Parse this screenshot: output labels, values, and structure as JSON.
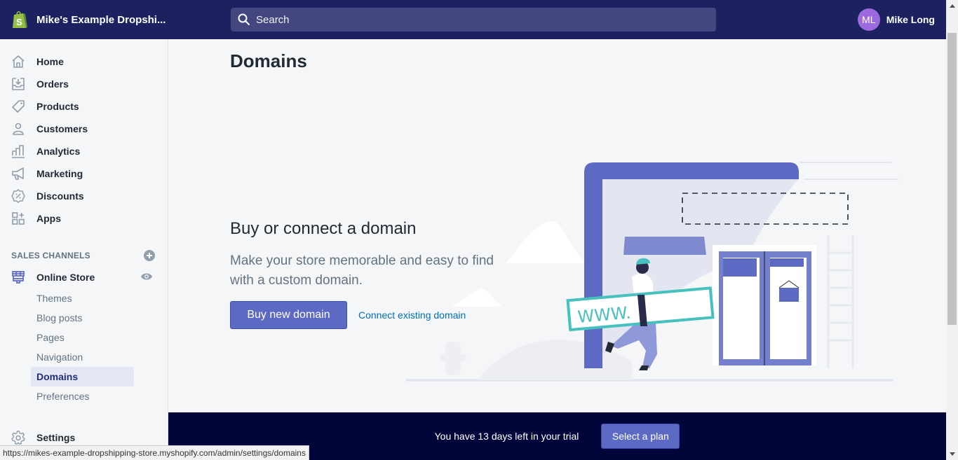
{
  "topbar": {
    "store_name": "Mike's Example Dropshi...",
    "search_placeholder": "Search",
    "user_initials": "ML",
    "user_name": "Mike Long"
  },
  "sidebar": {
    "items": [
      {
        "label": "Home",
        "icon": "home-icon"
      },
      {
        "label": "Orders",
        "icon": "orders-icon"
      },
      {
        "label": "Products",
        "icon": "tag-icon"
      },
      {
        "label": "Customers",
        "icon": "person-icon"
      },
      {
        "label": "Analytics",
        "icon": "bar-chart-icon"
      },
      {
        "label": "Marketing",
        "icon": "megaphone-icon"
      },
      {
        "label": "Discounts",
        "icon": "discount-icon"
      },
      {
        "label": "Apps",
        "icon": "apps-icon"
      }
    ],
    "sales_channels_label": "SALES CHANNELS",
    "online_store_label": "Online Store",
    "sub_items": [
      {
        "label": "Themes",
        "active": false
      },
      {
        "label": "Blog posts",
        "active": false
      },
      {
        "label": "Pages",
        "active": false
      },
      {
        "label": "Navigation",
        "active": false
      },
      {
        "label": "Domains",
        "active": true
      },
      {
        "label": "Preferences",
        "active": false
      }
    ],
    "settings_label": "Settings"
  },
  "main": {
    "page_title": "Domains",
    "hero_title": "Buy or connect a domain",
    "hero_text": "Make your store memorable and easy to find with a custom domain.",
    "primary_button": "Buy new domain",
    "secondary_link": "Connect existing domain",
    "illustration_sign_text": "WWW."
  },
  "trial": {
    "text": "You have 13 days left in your trial",
    "button": "Select a plan"
  },
  "statusbar": {
    "url": "https://mikes-example-dropshipping-store.myshopify.com/admin/settings/domains"
  },
  "colors": {
    "topbar": "#1c2260",
    "accent": "#5c6ac4",
    "trial_bar": "#000639",
    "link": "#006fbb",
    "avatar": "#9c6ade",
    "sign_teal": "#47c1bf"
  }
}
